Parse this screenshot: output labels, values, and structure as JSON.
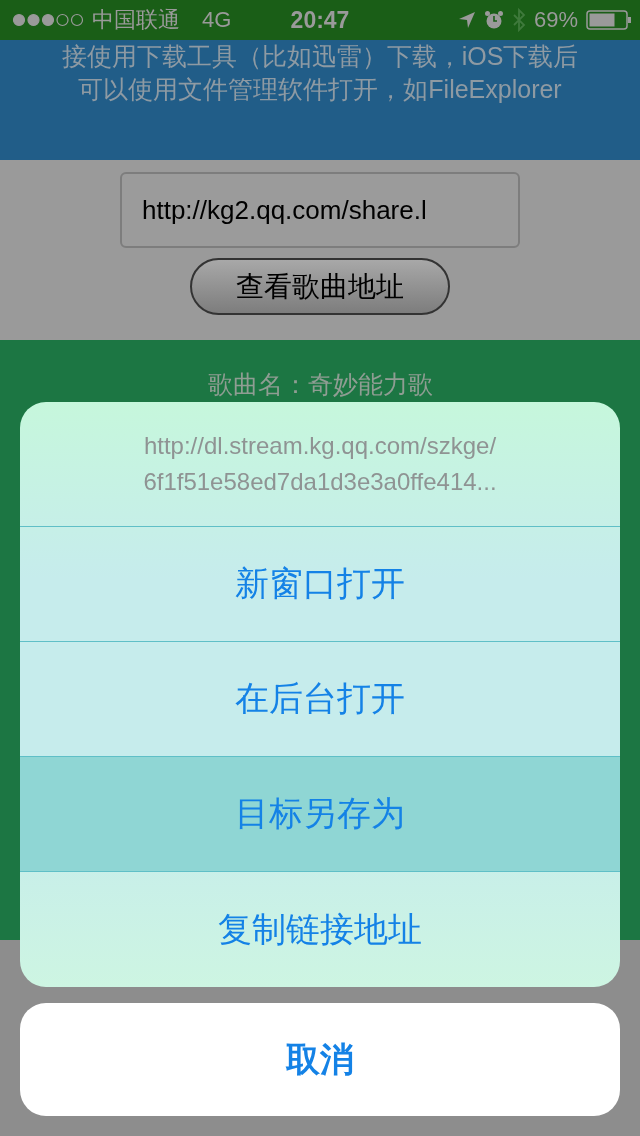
{
  "status_bar": {
    "carrier": "中国联通",
    "network": "4G",
    "time": "20:47",
    "battery": "69%"
  },
  "notice": {
    "lines": [
      "接使用下载工具（比如迅雷）下载，iOS下载后",
      "可以使用文件管理软件打开，如FileExplorer"
    ]
  },
  "url_field": {
    "value": "http://kg2.qq.com/share.l"
  },
  "lookup_button": {
    "label": "查看歌曲地址"
  },
  "song": {
    "label": "歌曲名：奇妙能力歌"
  },
  "action_sheet": {
    "url_lines": [
      "http://dl.stream.kg.qq.com/szkge/",
      "6f1f51e58ed7da1d3e3a0ffe414..."
    ],
    "actions": [
      {
        "label": "新窗口打开",
        "selected": false
      },
      {
        "label": "在后台打开",
        "selected": false
      },
      {
        "label": "目标另存为",
        "selected": true
      },
      {
        "label": "复制链接地址",
        "selected": false
      }
    ],
    "cancel": "取消"
  }
}
